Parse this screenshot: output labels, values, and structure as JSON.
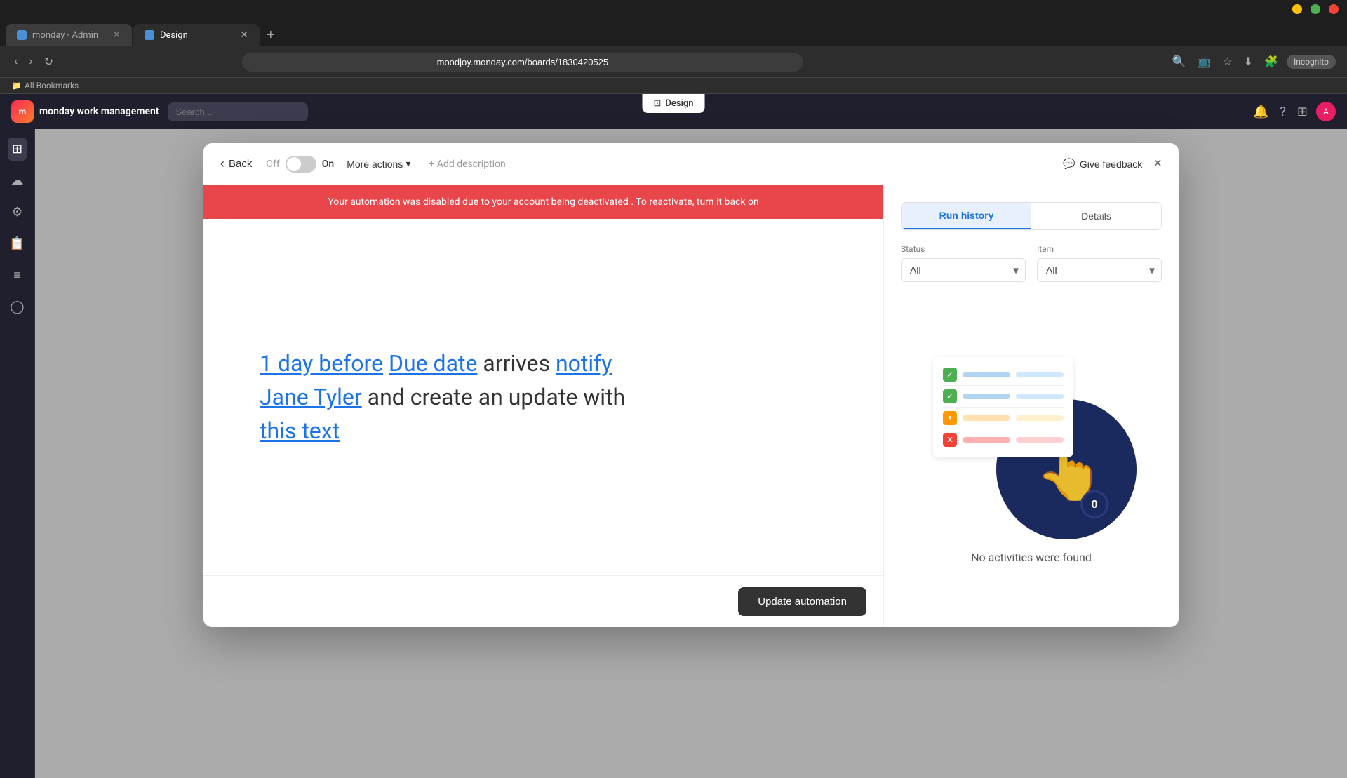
{
  "browser": {
    "tabs": [
      {
        "id": "tab-admin",
        "label": "monday - Admin",
        "icon": "🟦",
        "active": false
      },
      {
        "id": "tab-design",
        "label": "Design",
        "icon": "🟦",
        "active": true
      }
    ],
    "new_tab_label": "+",
    "url": "moodjoy.monday.com/boards/1830420525",
    "incognito_label": "Incognito",
    "bookmarks_label": "All Bookmarks"
  },
  "app": {
    "title": "monday work management",
    "design_tab_label": "Design"
  },
  "modal": {
    "back_label": "Back",
    "toggle_off_label": "Off",
    "toggle_on_label": "On",
    "more_actions_label": "More actions",
    "add_description_label": "+ Add description",
    "give_feedback_label": "Give feedback",
    "close_label": "×",
    "alert_message": "Your automation was disabled due to your",
    "alert_link_text": "account being deactivated",
    "alert_suffix": ". To reactivate, turn it back on",
    "automation_parts": {
      "part1": "1 day before",
      "part2": "Due date",
      "part3": "arrives",
      "part4": "notify",
      "part5": "Jane Tyler",
      "part6": "and create an update with",
      "part7": "this text"
    },
    "update_button_label": "Update automation"
  },
  "right_panel": {
    "tabs": [
      {
        "id": "run-history",
        "label": "Run history",
        "active": true
      },
      {
        "id": "details",
        "label": "Details",
        "active": false
      }
    ],
    "status_label": "Status",
    "item_label": "Item",
    "status_options": [
      "All"
    ],
    "item_options": [
      "All"
    ],
    "status_value": "All",
    "item_value": "All",
    "no_activities_label": "No activities were found",
    "list_rows": [
      {
        "type": "green",
        "check": "✓"
      },
      {
        "type": "green",
        "check": "✓"
      },
      {
        "type": "orange",
        "check": "○"
      },
      {
        "type": "red",
        "check": "✕"
      }
    ]
  },
  "sidebar": {
    "icons": [
      "⊞",
      "☁",
      "⚙",
      "📋",
      "≡",
      "◯"
    ]
  }
}
